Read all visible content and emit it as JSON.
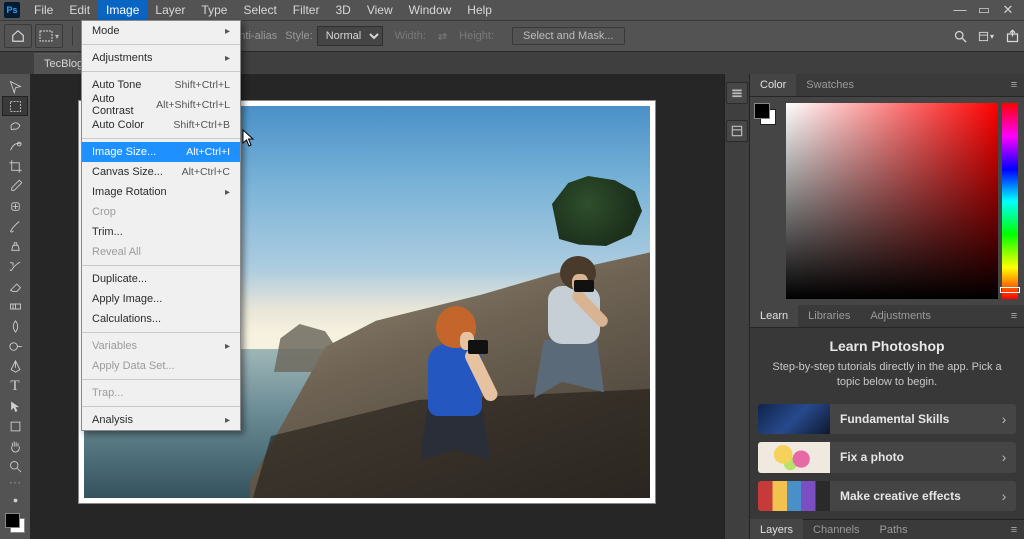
{
  "menubar": {
    "items": [
      "File",
      "Edit",
      "Image",
      "Layer",
      "Type",
      "Select",
      "Filter",
      "3D",
      "View",
      "Window",
      "Help"
    ],
    "active_index": 2
  },
  "optionsbar": {
    "antialias": "Anti-alias",
    "style_label": "Style:",
    "style_value": "Normal",
    "width_label": "Width:",
    "height_label": "Height:",
    "select_mask": "Select and Mask..."
  },
  "document": {
    "tab_title": "TecBlogger..."
  },
  "dropdown": {
    "groups": [
      [
        {
          "label": "Mode",
          "sub": true
        }
      ],
      [
        {
          "label": "Adjustments",
          "sub": true
        }
      ],
      [
        {
          "label": "Auto Tone",
          "shortcut": "Shift+Ctrl+L"
        },
        {
          "label": "Auto Contrast",
          "shortcut": "Alt+Shift+Ctrl+L"
        },
        {
          "label": "Auto Color",
          "shortcut": "Shift+Ctrl+B"
        }
      ],
      [
        {
          "label": "Image Size...",
          "shortcut": "Alt+Ctrl+I",
          "highlight": true
        },
        {
          "label": "Canvas Size...",
          "shortcut": "Alt+Ctrl+C"
        },
        {
          "label": "Image Rotation",
          "sub": true
        },
        {
          "label": "Crop",
          "disabled": true
        },
        {
          "label": "Trim..."
        },
        {
          "label": "Reveal All",
          "disabled": true
        }
      ],
      [
        {
          "label": "Duplicate..."
        },
        {
          "label": "Apply Image..."
        },
        {
          "label": "Calculations..."
        }
      ],
      [
        {
          "label": "Variables",
          "sub": true,
          "disabled": true
        },
        {
          "label": "Apply Data Set...",
          "disabled": true
        }
      ],
      [
        {
          "label": "Trap...",
          "disabled": true
        }
      ],
      [
        {
          "label": "Analysis",
          "sub": true
        }
      ]
    ]
  },
  "panels": {
    "color_tabs": [
      "Color",
      "Swatches"
    ],
    "mid_tabs": [
      "Learn",
      "Libraries",
      "Adjustments"
    ],
    "learn": {
      "title": "Learn Photoshop",
      "subtitle": "Step-by-step tutorials directly in the app. Pick a topic below to begin.",
      "items": [
        {
          "label": "Fundamental Skills",
          "thumb": "linear-gradient(135deg,#10234a 0%, #274a8d 50%, #0e1830 100%)"
        },
        {
          "label": "Fix a photo",
          "thumb": "radial-gradient(circle at 35% 40%, #f5d25a 0 18%, transparent 19%), radial-gradient(circle at 60% 55%, #e86aa5 0 18%, transparent 19%), radial-gradient(circle at 45% 70%, #b7e36b 0 14%, transparent 15%), #efe9df"
        },
        {
          "label": "Make creative effects",
          "thumb": "linear-gradient(90deg,#c63a3a 0 20%, #f2c14e 20% 40%, #4a90c8 40% 60%, #7a4fc1 60% 80%, #2a2a2a 80% 100%)"
        }
      ]
    },
    "bottom_tabs": [
      "Layers",
      "Channels",
      "Paths"
    ]
  }
}
